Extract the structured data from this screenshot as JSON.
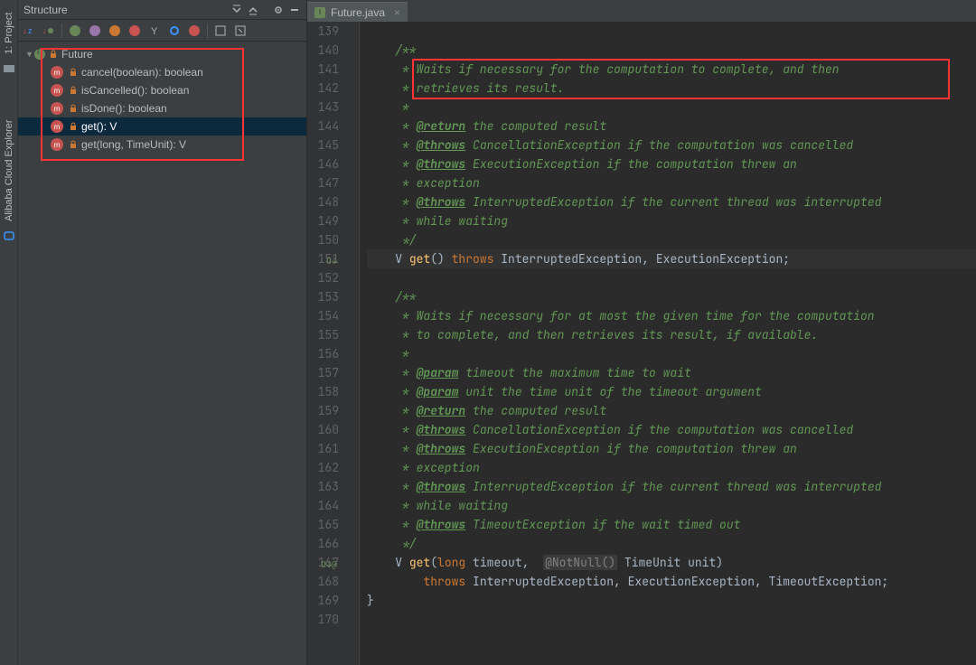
{
  "sidebar": {
    "project_label": "1: Project",
    "alibaba_label": "Alibaba Cloud Explorer"
  },
  "structure_panel": {
    "title": "Structure"
  },
  "tree": {
    "root": "Future",
    "items": [
      "cancel(boolean): boolean",
      "isCancelled(): boolean",
      "isDone(): boolean",
      "get(): V",
      "get(long, TimeUnit): V"
    ]
  },
  "tab": {
    "name": "Future.java"
  },
  "code": {
    "lines": [
      {
        "n": 139,
        "t": ""
      },
      {
        "n": 140,
        "t": "    /**",
        "cls": "doc"
      },
      {
        "n": 141,
        "t": "     * Waits if necessary for the computation to complete, and then",
        "cls": "doc"
      },
      {
        "n": 142,
        "t": "     * retrieves its result.",
        "cls": "doc"
      },
      {
        "n": 143,
        "t": "     *",
        "cls": "doc"
      },
      {
        "n": 144,
        "seg": [
          [
            "     * ",
            "doc"
          ],
          [
            "@return",
            "tag"
          ],
          [
            " the computed result",
            "doc"
          ]
        ]
      },
      {
        "n": 145,
        "seg": [
          [
            "     * ",
            "doc"
          ],
          [
            "@throws",
            "tag"
          ],
          [
            " CancellationException",
            " docb"
          ],
          [
            " if the computation was cancelled",
            "doc"
          ]
        ]
      },
      {
        "n": 146,
        "seg": [
          [
            "     * ",
            "doc"
          ],
          [
            "@throws",
            "tag"
          ],
          [
            " ExecutionException",
            " docb"
          ],
          [
            " if the computation threw an",
            "doc"
          ]
        ]
      },
      {
        "n": 147,
        "t": "     * exception",
        "cls": "doc"
      },
      {
        "n": 148,
        "seg": [
          [
            "     * ",
            "doc"
          ],
          [
            "@throws",
            "tag"
          ],
          [
            " InterruptedException",
            " docb"
          ],
          [
            " if the current thread was interrupted",
            "doc"
          ]
        ]
      },
      {
        "n": 149,
        "t": "     * while waiting",
        "cls": "doc"
      },
      {
        "n": 150,
        "t": "     */",
        "cls": "doc"
      },
      {
        "n": 151,
        "seg": [
          [
            "    ",
            "p"
          ],
          [
            "V ",
            "type"
          ],
          [
            "get",
            "id"
          ],
          [
            "() ",
            "p"
          ],
          [
            "throws ",
            "kw"
          ],
          [
            "InterruptedException",
            ""
          ],
          [
            ", ",
            ""
          ],
          [
            "ExecutionException",
            ""
          ],
          [
            ";",
            ""
          ]
        ],
        "hl": true,
        "gic": "O↓"
      },
      {
        "n": 152,
        "t": ""
      },
      {
        "n": 153,
        "t": "    /**",
        "cls": "doc"
      },
      {
        "n": 154,
        "t": "     * Waits if necessary for at most the given time for the computation",
        "cls": "doc"
      },
      {
        "n": 155,
        "t": "     * to complete, and then retrieves its result, if available.",
        "cls": "doc"
      },
      {
        "n": 156,
        "t": "     *",
        "cls": "doc"
      },
      {
        "n": 157,
        "seg": [
          [
            "     * ",
            "doc"
          ],
          [
            "@param",
            "tag"
          ],
          [
            " timeout",
            " docb"
          ],
          [
            " the maximum time to wait",
            "doc"
          ]
        ]
      },
      {
        "n": 158,
        "seg": [
          [
            "     * ",
            "doc"
          ],
          [
            "@param",
            "tag"
          ],
          [
            " unit",
            " docb"
          ],
          [
            " the time unit of the timeout argument",
            "doc"
          ]
        ]
      },
      {
        "n": 159,
        "seg": [
          [
            "     * ",
            "doc"
          ],
          [
            "@return",
            "tag"
          ],
          [
            " the computed result",
            "doc"
          ]
        ]
      },
      {
        "n": 160,
        "seg": [
          [
            "     * ",
            "doc"
          ],
          [
            "@throws",
            "tag"
          ],
          [
            " CancellationException",
            " docb"
          ],
          [
            " if the computation was cancelled",
            "doc"
          ]
        ]
      },
      {
        "n": 161,
        "seg": [
          [
            "     * ",
            "doc"
          ],
          [
            "@throws",
            "tag"
          ],
          [
            " ExecutionException",
            " docb"
          ],
          [
            " if the computation threw an",
            "doc"
          ]
        ]
      },
      {
        "n": 162,
        "t": "     * exception",
        "cls": "doc"
      },
      {
        "n": 163,
        "seg": [
          [
            "     * ",
            "doc"
          ],
          [
            "@throws",
            "tag"
          ],
          [
            " InterruptedException",
            " docb"
          ],
          [
            " if the current thread was interrupted",
            "doc"
          ]
        ]
      },
      {
        "n": 164,
        "t": "     * while waiting",
        "cls": "doc"
      },
      {
        "n": 165,
        "seg": [
          [
            "     * ",
            "doc"
          ],
          [
            "@throws",
            "tag"
          ],
          [
            " TimeoutException",
            " docb"
          ],
          [
            " if the wait timed out",
            "doc"
          ]
        ]
      },
      {
        "n": 166,
        "t": "     */",
        "cls": "doc"
      },
      {
        "n": 167,
        "seg": [
          [
            "    ",
            "p"
          ],
          [
            "V ",
            "type"
          ],
          [
            "get",
            "id"
          ],
          [
            "(",
            "p"
          ],
          [
            "long ",
            "kw"
          ],
          [
            "timeout,  ",
            "p"
          ],
          [
            "@NotNull()",
            "ann"
          ],
          [
            " TimeUnit unit)",
            "p"
          ]
        ],
        "gic": "O↓@"
      },
      {
        "n": 168,
        "seg": [
          [
            "        ",
            "p"
          ],
          [
            "throws ",
            "kw"
          ],
          [
            "InterruptedException, ExecutionException, TimeoutException;",
            "p"
          ]
        ]
      },
      {
        "n": 169,
        "t": "}"
      },
      {
        "n": 170,
        "t": ""
      }
    ]
  }
}
